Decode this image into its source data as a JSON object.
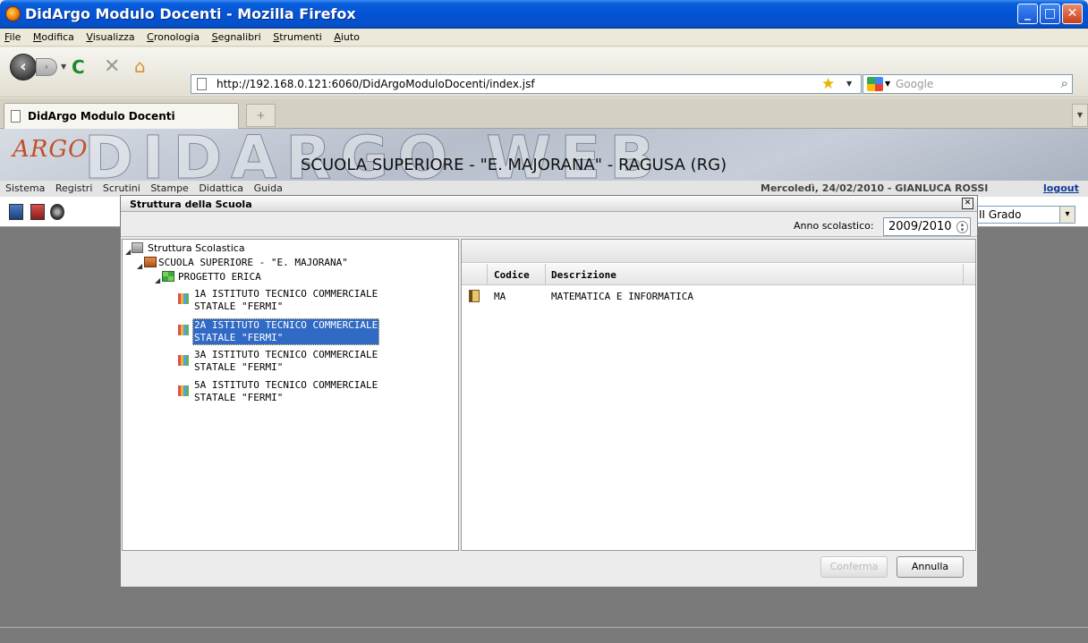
{
  "window": {
    "title": "DidArgo Modulo Docenti - Mozilla Firefox",
    "buttons": {
      "minimize": "_",
      "maximize": "□",
      "close": "✕"
    }
  },
  "menubar": [
    "File",
    "Modifica",
    "Visualizza",
    "Cronologia",
    "Segnalibri",
    "Strumenti",
    "Aiuto"
  ],
  "navbar": {
    "url": "http://192.168.0.121:6060/DidArgoModuloDocenti/index.jsf",
    "search_placeholder": "Google"
  },
  "tabs": [
    {
      "label": "DidArgo Modulo Docenti"
    }
  ],
  "app": {
    "logo_argo": "ARGO",
    "logo_didargo": "DIDARGO WEB",
    "school_title": "SCUOLA SUPERIORE - \"E. MAJORANA\" - RAGUSA (RG)",
    "menu": [
      "Sistema",
      "Registri",
      "Scrutini",
      "Stampe",
      "Didattica",
      "Guida"
    ],
    "date_user": "Mercoledì, 24/02/2010 - GIANLUCA ROSSI",
    "logout": "logout",
    "grado_value": "II Grado"
  },
  "dialog": {
    "title": "Struttura della Scuola",
    "year_label": "Anno scolastico:",
    "year_value": "2009/2010",
    "tree": {
      "root": "Struttura Scolastica",
      "school": "SCUOLA SUPERIORE - \"E. MAJORANA\"",
      "project": "PROGETTO ERICA",
      "classes": [
        {
          "line1": "1A ISTITUTO TECNICO COMMERCIALE",
          "line2": "STATALE \"FERMI\""
        },
        {
          "line1": "2A ISTITUTO TECNICO COMMERCIALE",
          "line2": "STATALE \"FERMI\""
        },
        {
          "line1": "3A ISTITUTO TECNICO COMMERCIALE",
          "line2": "STATALE \"FERMI\""
        },
        {
          "line1": "5A ISTITUTO TECNICO COMMERCIALE",
          "line2": "STATALE \"FERMI\""
        }
      ]
    },
    "grid": {
      "columns": [
        "Codice",
        "Descrizione"
      ],
      "rows": [
        {
          "codice": "MA",
          "descrizione": "MATEMATICA E INFORMATICA"
        }
      ]
    },
    "confirm_label": "Conferma",
    "cancel_label": "Annulla"
  }
}
